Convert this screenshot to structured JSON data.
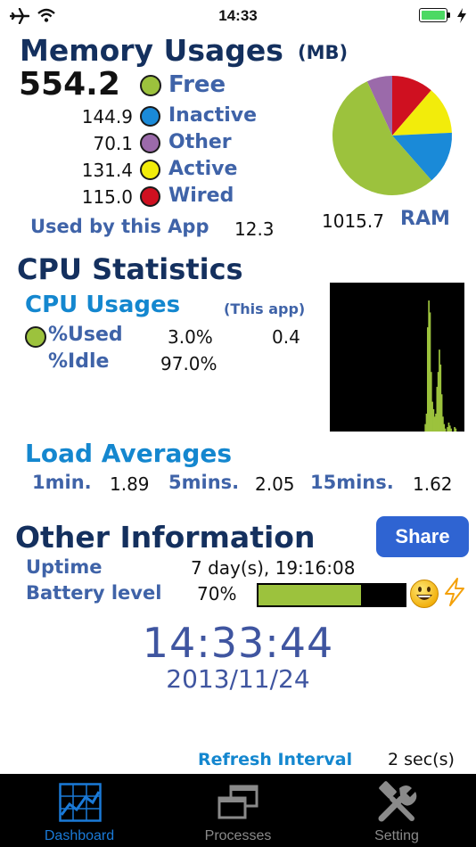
{
  "status_bar": {
    "time": "14:33"
  },
  "memory": {
    "title": "Memory Usages",
    "unit": "(MB)",
    "free_value": "554.2",
    "free_label": "Free",
    "rows": [
      {
        "value": "144.9",
        "label": "Inactive",
        "color": "#1a8ad8"
      },
      {
        "value": "70.1",
        "label": "Other",
        "color": "#9b6aaa"
      },
      {
        "value": "131.4",
        "label": "Active",
        "color": "#f2ec0b"
      },
      {
        "value": "115.0",
        "label": "Wired",
        "color": "#cf1020"
      }
    ],
    "free_color": "#9cc23d",
    "used_by_app_label": "Used by this App",
    "used_by_app_value": "12.3",
    "ram_value": "1015.7",
    "ram_label": "RAM",
    "pie": [
      {
        "name": "Free",
        "value": 554.2,
        "color": "#9cc23d"
      },
      {
        "name": "Inactive",
        "value": 144.9,
        "color": "#1a8ad8"
      },
      {
        "name": "Active",
        "value": 131.4,
        "color": "#f2ec0b"
      },
      {
        "name": "Wired",
        "value": 115.0,
        "color": "#cf1020"
      },
      {
        "name": "Other",
        "value": 70.1,
        "color": "#9b6aaa"
      }
    ]
  },
  "cpu": {
    "title": "CPU Statistics",
    "usages_label": "CPU Usages",
    "this_app_label": "(This app)",
    "used_label": "%Used",
    "used_value": "3.0%",
    "used_app_value": "0.4",
    "idle_label": "%Idle",
    "idle_value": "97.0%",
    "graph_color": "#9cc23d",
    "history": [
      0,
      0,
      0,
      0,
      0,
      0,
      0,
      0,
      0,
      0,
      0,
      0,
      0,
      0,
      0,
      0,
      0,
      0,
      0,
      0,
      0,
      0,
      0,
      0,
      0,
      0,
      0,
      0,
      0,
      0,
      0,
      0,
      0,
      0,
      0,
      0,
      0,
      0,
      0,
      0,
      0,
      0,
      0,
      0,
      0,
      0,
      0,
      0,
      0,
      0,
      0,
      0,
      0,
      0,
      0,
      0,
      0,
      0,
      0,
      0,
      0,
      0,
      0,
      0,
      0,
      0,
      0,
      0,
      0,
      0,
      0,
      0,
      0,
      0,
      0,
      0,
      0,
      0,
      0,
      0,
      0,
      5,
      12,
      70,
      88,
      80,
      40,
      20,
      15,
      10,
      12,
      30,
      40,
      55,
      45,
      25,
      10,
      5,
      2,
      0,
      3,
      6,
      4,
      2,
      0,
      0,
      3,
      2,
      0,
      0,
      0,
      0,
      0,
      0,
      0
    ]
  },
  "load": {
    "title": "Load Averages",
    "items": [
      {
        "label": "1min.",
        "value": "1.89"
      },
      {
        "label": "5mins.",
        "value": "2.05"
      },
      {
        "label": "15mins.",
        "value": "1.62"
      }
    ]
  },
  "other": {
    "title": "Other Information",
    "share_label": "Share",
    "uptime_label": "Uptime",
    "uptime_value": "7 day(s), 19:16:08",
    "battery_label": "Battery level",
    "battery_value": "70%",
    "battery_level": 0.7,
    "clock": "14:33:44",
    "date": "2013/11/24"
  },
  "refresh": {
    "label": "Refresh Interval",
    "value": "2 sec(s)"
  },
  "tabs": [
    {
      "label": "Dashboard",
      "icon": "dashboard-chart-icon",
      "active": true
    },
    {
      "label": "Processes",
      "icon": "processes-windows-icon",
      "active": false
    },
    {
      "label": "Setting",
      "icon": "setting-tools-icon",
      "active": false
    }
  ]
}
